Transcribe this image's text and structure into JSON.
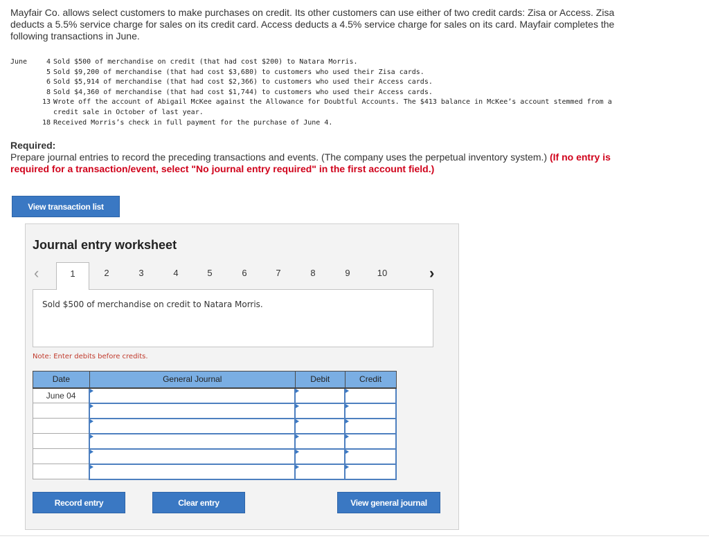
{
  "intro": "Mayfair Co. allows select customers to make purchases on credit. Its other customers can use either of two credit cards: Zisa or Access. Zisa deducts a 5.5% service charge for sales on its credit card. Access deducts a 4.5% service charge for sales on its card. Mayfair completes the following transactions in June.",
  "transactions": {
    "month": "June",
    "items": [
      {
        "day": "4",
        "text": "Sold $500 of merchandise on credit (that had cost $200) to Natara Morris."
      },
      {
        "day": "5",
        "text": "Sold $9,200 of merchandise (that had cost $3,680) to customers who used their Zisa cards."
      },
      {
        "day": "6",
        "text": "Sold $5,914 of merchandise (that had cost $2,366) to customers who used their Access cards."
      },
      {
        "day": "8",
        "text": "Sold $4,360 of merchandise (that had cost $1,744) to customers who used their Access cards."
      },
      {
        "day": "13",
        "text": "Wrote off the account of Abigail McKee against the Allowance for Doubtful Accounts. The $413 balance in McKee’s account stemmed from a credit sale in October of last year."
      },
      {
        "day": "18",
        "text": "Received Morris’s check in full payment for the purchase of June 4."
      }
    ]
  },
  "required": {
    "label": "Required:",
    "text": "Prepare journal entries to record the preceding transactions and events. (The company uses the perpetual inventory system.) ",
    "red": "(If no entry is required for a transaction/event, select \"No journal entry required\" in the first account field.)"
  },
  "view_transaction_list": "View transaction list",
  "worksheet": {
    "title": "Journal entry worksheet",
    "tabs": [
      "1",
      "2",
      "3",
      "4",
      "5",
      "6",
      "7",
      "8",
      "9",
      "10"
    ],
    "active_tab": "1",
    "description": "Sold $500 of merchandise on credit to Natara Morris.",
    "note": "Note: Enter debits before credits.",
    "columns": [
      "Date",
      "General Journal",
      "Debit",
      "Credit"
    ],
    "rows": [
      {
        "date": "June 04"
      },
      {
        "date": ""
      },
      {
        "date": ""
      },
      {
        "date": ""
      },
      {
        "date": ""
      },
      {
        "date": ""
      }
    ],
    "record": "Record entry",
    "clear": "Clear entry",
    "view_journal": "View general journal"
  },
  "colors": {
    "button": "#3a78c3",
    "header": "#7aaee3",
    "note": "#c0392b",
    "red": "#d0021b"
  }
}
